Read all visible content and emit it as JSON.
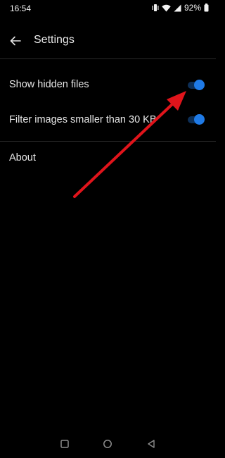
{
  "status_bar": {
    "time": "16:54",
    "battery": "92%",
    "icons": [
      "vibrate-icon",
      "wifi-icon",
      "signal-icon",
      "battery-icon"
    ]
  },
  "header": {
    "title": "Settings",
    "back_icon": "arrow-left-icon"
  },
  "settings": {
    "items": [
      {
        "label": "Show hidden files",
        "enabled": true
      },
      {
        "label": "Filter images smaller than 30 KB",
        "enabled": true
      }
    ],
    "about_label": "About"
  },
  "colors": {
    "background": "#000000",
    "accent": "#1f7ae6",
    "toggle_track": "#0d2f57",
    "annotation_arrow": "#e0141b"
  },
  "nav_bar": {
    "icons": [
      "recents-square-icon",
      "home-circle-icon",
      "back-triangle-icon"
    ]
  }
}
